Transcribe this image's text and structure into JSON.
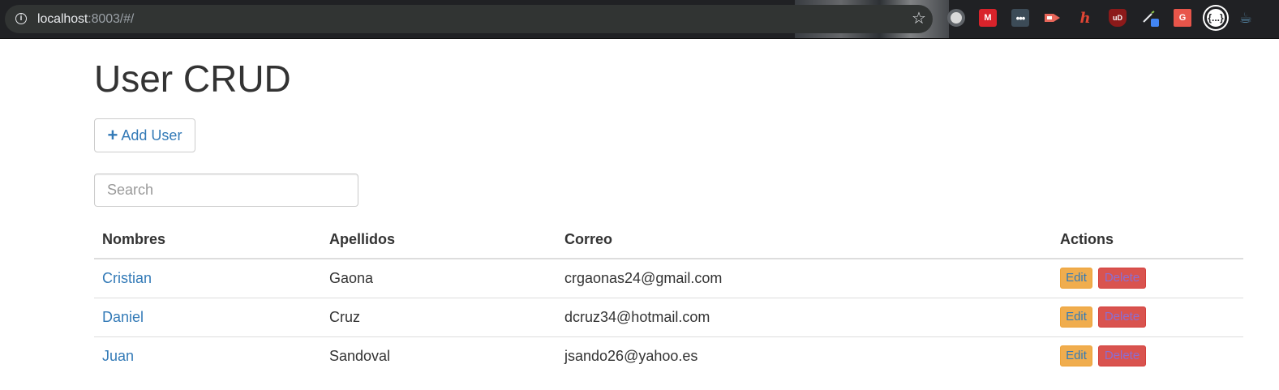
{
  "browser": {
    "url_host": "localhost",
    "url_rest": ":8003/#/",
    "extensions": [
      "record-icon",
      "mendeley-icon",
      "more-dots-icon",
      "cast-icon",
      "hypothesis-icon",
      "ublock-icon",
      "pen-icon",
      "screen-cast-icon",
      "json-viewer-icon",
      "java-icon"
    ]
  },
  "page": {
    "title": "User CRUD",
    "add_button_label": "Add User",
    "search_placeholder": "Search"
  },
  "table": {
    "headers": [
      "Nombres",
      "Apellidos",
      "Correo",
      "Actions"
    ],
    "rows": [
      {
        "nombre": "Cristian",
        "apellido": "Gaona",
        "correo": "crgaonas24@gmail.com"
      },
      {
        "nombre": "Daniel",
        "apellido": "Cruz",
        "correo": "dcruz34@hotmail.com"
      },
      {
        "nombre": "Juan",
        "apellido": "Sandoval",
        "correo": "jsando26@yahoo.es"
      }
    ],
    "edit_label": "Edit",
    "delete_label": "Delete"
  },
  "colors": {
    "link": "#337ab7",
    "edit": "#f0ad4e",
    "delete": "#d9534f"
  }
}
